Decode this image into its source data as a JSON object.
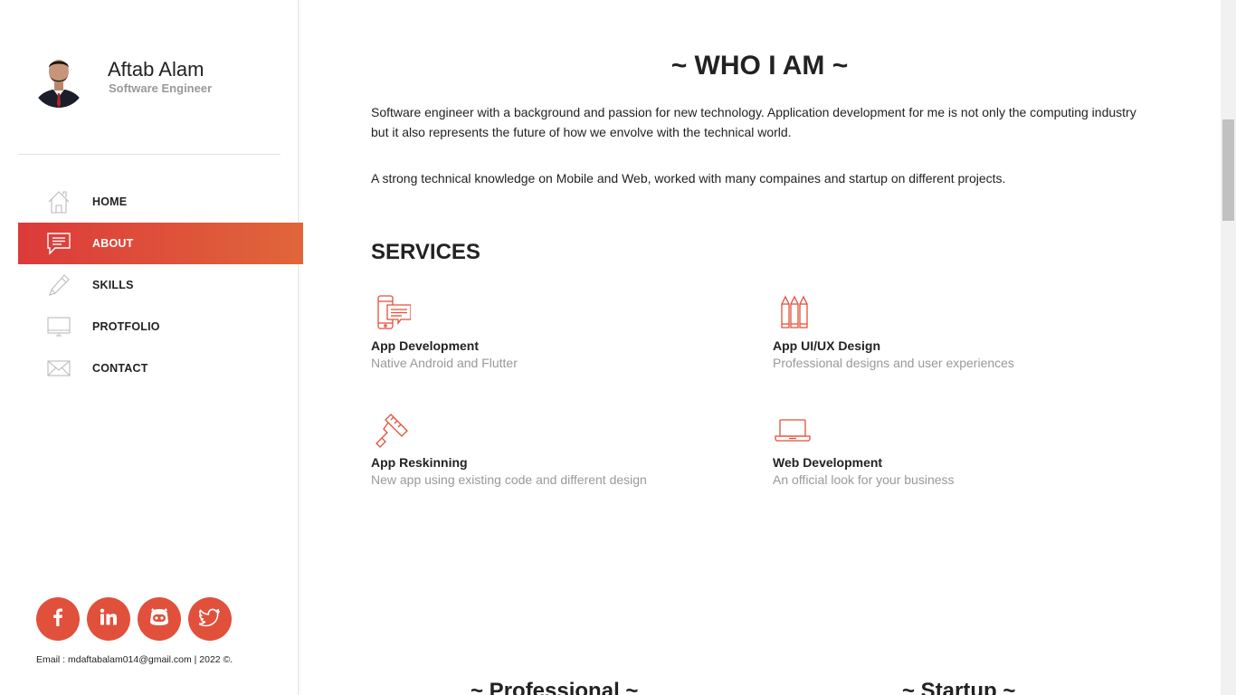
{
  "profile": {
    "name": "Aftab Alam",
    "role": "Software Engineer"
  },
  "nav": {
    "items": [
      {
        "label": "HOME",
        "icon": "home-icon"
      },
      {
        "label": "ABOUT",
        "icon": "chat-icon",
        "active": true
      },
      {
        "label": "SKILLS",
        "icon": "pencil-icon"
      },
      {
        "label": "PROTFOLIO",
        "icon": "monitor-icon"
      },
      {
        "label": "CONTACT",
        "icon": "envelope-icon"
      }
    ]
  },
  "socials": [
    "facebook-icon",
    "linkedin-icon",
    "github-icon",
    "twitter-icon"
  ],
  "footer": {
    "text": "Email : mdaftabalam014@gmail.com | 2022 ©."
  },
  "about": {
    "title": "~ WHO I AM ~",
    "paragraph1": "Software engineer with a background and passion for new technology. Application development for me is not only the computing industry but it also represents the future of how we envolve with the technical world.",
    "paragraph2": "A strong technical knowledge on Mobile and Web, worked with many compaines and startup on different projects."
  },
  "services": {
    "title": "SERVICES",
    "items": [
      {
        "title": "App Development",
        "desc": "Native Android and Flutter",
        "icon": "mobile-chat-icon"
      },
      {
        "title": "App UI/UX Design",
        "desc": "Professional designs and user experiences",
        "icon": "pencils-icon"
      },
      {
        "title": "App Reskinning",
        "desc": "New app using existing code and different design",
        "icon": "paint-roller-icon"
      },
      {
        "title": "Web Development",
        "desc": "An official look for your business",
        "icon": "laptop-icon"
      }
    ]
  },
  "bottom": {
    "professional": "~ Professional ~",
    "startup": "~ Startup ~"
  },
  "colors": {
    "accent": "#e1503b",
    "gradient_start": "#dc3a3a",
    "gradient_end": "#e0663a"
  }
}
